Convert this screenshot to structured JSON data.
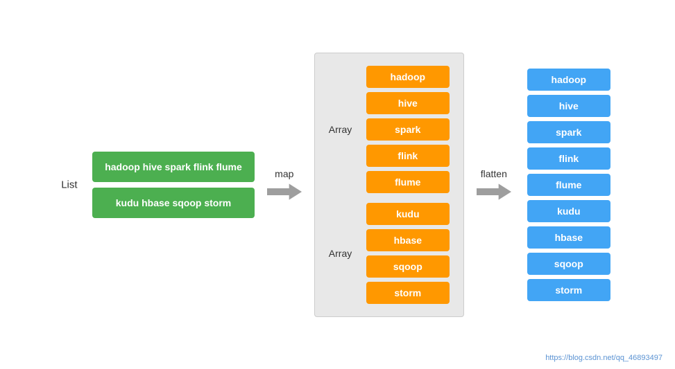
{
  "list_label": "List",
  "map_label": "map",
  "flatten_label": "flatten",
  "green_boxes": [
    "hadoop hive spark flink flume",
    "kudu hbase sqoop storm"
  ],
  "array_groups": [
    {
      "label": "Array",
      "items": [
        "hadoop",
        "hive",
        "spark",
        "flink",
        "flume"
      ]
    },
    {
      "label": "Array",
      "items": [
        "kudu",
        "hbase",
        "sqoop",
        "storm"
      ]
    }
  ],
  "flat_items": [
    "hadoop",
    "hive",
    "spark",
    "flink",
    "flume",
    "kudu",
    "hbase",
    "sqoop",
    "storm"
  ],
  "watermark": "https://blog.csdn.net/qq_46893497"
}
